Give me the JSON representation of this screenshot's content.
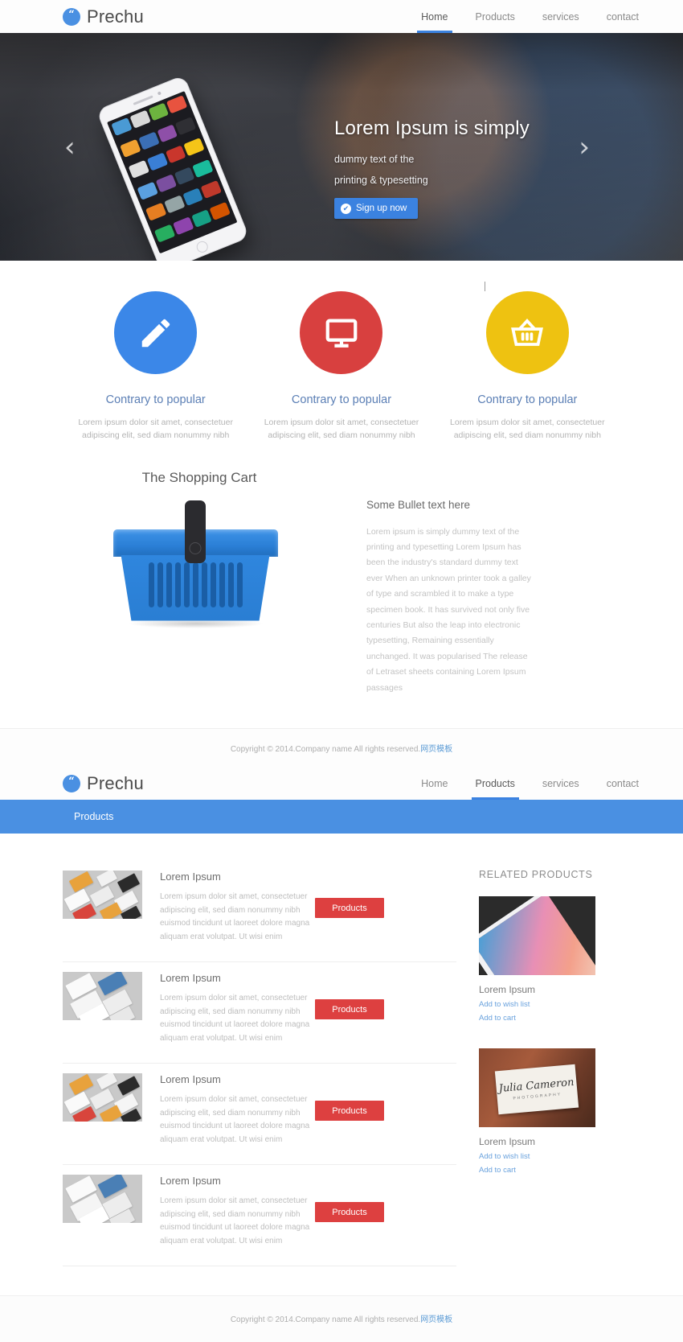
{
  "brand": {
    "name": "Prechu",
    "badge_icon": "quote-icon"
  },
  "nav": {
    "home": "Home",
    "products": "Products",
    "services": "services",
    "contact": "contact"
  },
  "hero": {
    "title": "Lorem Ipsum is simply",
    "line1": "dummy text of the",
    "line2": "printing & typesetting",
    "button": "Sign up now",
    "prev_arrow": "‹",
    "next_arrow": "›"
  },
  "features": [
    {
      "icon": "pencil-icon",
      "color": "#3b87e8",
      "title": "Contrary to popular",
      "text": "Lorem ipsum dolor sit amet, consectetuer adipiscing elit, sed diam nonummy nibh"
    },
    {
      "icon": "monitor-icon",
      "color": "#d8403f",
      "title": "Contrary to popular",
      "text": "Lorem ipsum dolor sit amet, consectetuer adipiscing elit, sed diam nonummy nibh"
    },
    {
      "icon": "basket-icon",
      "color": "#eec211",
      "title": "Contrary to popular",
      "text": "Lorem ipsum dolor sit amet, consectetuer adipiscing elit, sed diam nonummy nibh"
    }
  ],
  "cart_section": {
    "heading": "The Shopping Cart",
    "image_name": "blue-shopping-basket",
    "bullet_title": "Some Bullet text here",
    "bullet_text": "Lorem ipsum is simply dummy text of the printing and typesetting Lorem Ipsum has been the industry's standard dummy text ever When an unknown printer took a galley of type and scrambled it to make a type specimen book. It has survived not only five centuries But also the leap into electronic typesetting, Remaining essentially unchanged. It was popularised The release of Letraset sheets containing Lorem Ipsum passages"
  },
  "footer": {
    "copyright_prefix": "Copyright © 2014.Company name All rights reserved.",
    "copyright_link": "网页模板"
  },
  "products_page": {
    "banner_title": "Products",
    "items": [
      {
        "title": "Lorem Ipsum",
        "desc": "Lorem ipsum dolor sit amet, consectetuer adipiscing elit, sed diam nonummy nibh euismod tincidunt ut laoreet dolore magna aliquam erat volutpat. Ut wisi enim",
        "button": "Products",
        "thumb": "business-cards-orange"
      },
      {
        "title": "Lorem Ipsum",
        "desc": "Lorem ipsum dolor sit amet, consectetuer adipiscing elit, sed diam nonummy nibh euismod tincidunt ut laoreet dolore magna aliquam erat volutpat. Ut wisi enim",
        "button": "Products",
        "thumb": "business-cards-white"
      },
      {
        "title": "Lorem Ipsum",
        "desc": "Lorem ipsum dolor sit amet, consectetuer adipiscing elit, sed diam nonummy nibh euismod tincidunt ut laoreet dolore magna aliquam erat volutpat. Ut wisi enim",
        "button": "Products",
        "thumb": "business-cards-orange"
      },
      {
        "title": "Lorem Ipsum",
        "desc": "Lorem ipsum dolor sit amet, consectetuer adipiscing elit, sed diam nonummy nibh euismod tincidunt ut laoreet dolore magna aliquam erat volutpat. Ut wisi enim",
        "button": "Products",
        "thumb": "business-cards-white"
      }
    ],
    "related": {
      "heading": "RELATED PRODUCTS",
      "items": [
        {
          "name": "Lorem Ipsum",
          "wishlist": "Add to wish list",
          "cart": "Add to cart",
          "thumb": "colorful-phone"
        },
        {
          "name": "Lorem Ipsum",
          "wishlist": "Add to wish list",
          "cart": "Add to cart",
          "thumb": "julia-cameron-logo",
          "logo_text": "Julia Cameron",
          "logo_sub": "PHOTOGRAPHY"
        }
      ]
    }
  }
}
